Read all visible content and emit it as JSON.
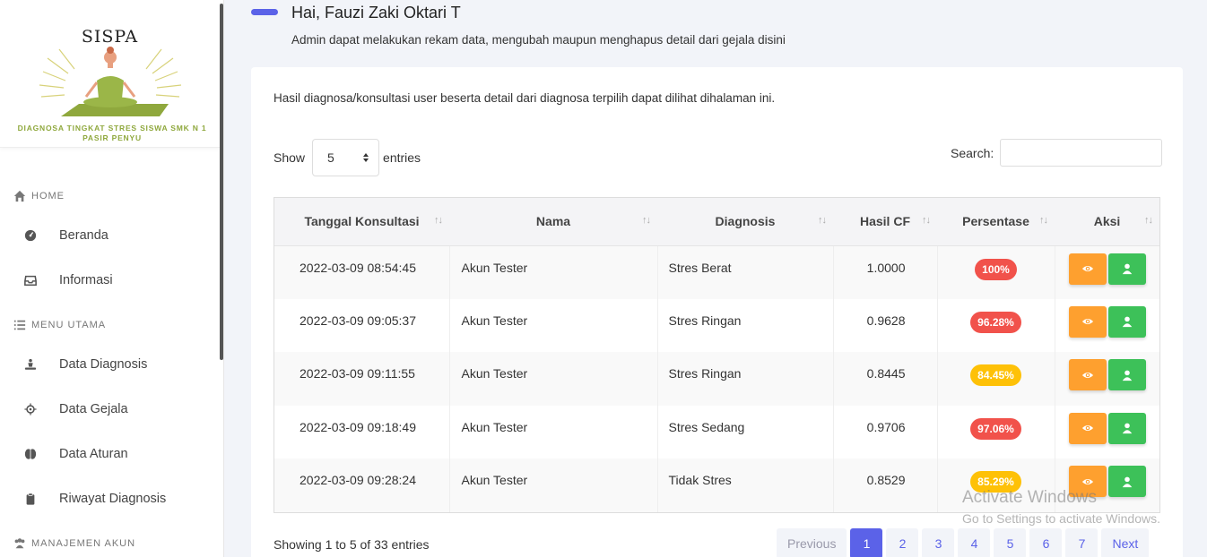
{
  "brand": {
    "title": "SISPA",
    "subtitle": "DIAGNOSA TINGKAT STRES SISWA SMK N 1 PASIR PENYU"
  },
  "sidebar": {
    "sections": [
      {
        "label": "HOME",
        "icon": "home-icon"
      },
      {
        "label": "MENU UTAMA",
        "icon": "list-icon"
      },
      {
        "label": "MANAJEMEN AKUN",
        "icon": "users-icon"
      }
    ],
    "items": [
      {
        "label": "Beranda",
        "icon": "dashboard-icon"
      },
      {
        "label": "Informasi",
        "icon": "inbox-icon"
      },
      {
        "label": "Data Diagnosis",
        "icon": "meditation-icon"
      },
      {
        "label": "Data Gejala",
        "icon": "virus-icon"
      },
      {
        "label": "Data Aturan",
        "icon": "brain-icon"
      },
      {
        "label": "Riwayat Diagnosis",
        "icon": "clipboard-icon"
      }
    ]
  },
  "header": {
    "greeting": "Hai, Fauzi Zaki Oktari T",
    "subtitle": "Admin dapat melakukan rekam data, mengubah maupun menghapus detail dari gejala disini"
  },
  "card": {
    "description": "Hasil diagnosa/konsultasi user beserta detail dari diagnosa terpilih dapat dilihat dihalaman ini."
  },
  "controls": {
    "show_label": "Show",
    "entries_label": "entries",
    "page_size": "5",
    "search_label": "Search:",
    "search_value": ""
  },
  "table": {
    "columns": [
      "Tanggal Konsultasi",
      "Nama",
      "Diagnosis",
      "Hasil CF",
      "Persentase",
      "Aksi"
    ],
    "rows": [
      {
        "date": "2022-03-09 08:54:45",
        "name": "Akun Tester",
        "diagnosis": "Stres Berat",
        "cf": "1.0000",
        "pct": "100%",
        "color": "#f1524b"
      },
      {
        "date": "2022-03-09 09:05:37",
        "name": "Akun Tester",
        "diagnosis": "Stres Ringan",
        "cf": "0.9628",
        "pct": "96.28%",
        "color": "#f1524b"
      },
      {
        "date": "2022-03-09 09:11:55",
        "name": "Akun Tester",
        "diagnosis": "Stres Ringan",
        "cf": "0.8445",
        "pct": "84.45%",
        "color": "#fec107"
      },
      {
        "date": "2022-03-09 09:18:49",
        "name": "Akun Tester",
        "diagnosis": "Stres Sedang",
        "cf": "0.9706",
        "pct": "97.06%",
        "color": "#f1524b"
      },
      {
        "date": "2022-03-09 09:28:24",
        "name": "Akun Tester",
        "diagnosis": "Tidak Stres",
        "cf": "0.8529",
        "pct": "85.29%",
        "color": "#fec107"
      }
    ],
    "action_colors": {
      "view": "#fea02f",
      "user": "#3dc159"
    }
  },
  "footer": {
    "info": "Showing 1 to 5 of 33 entries",
    "pagination": {
      "previous": "Previous",
      "pages": [
        "1",
        "2",
        "3",
        "4",
        "5",
        "6",
        "7"
      ],
      "active": "1",
      "next": "Next"
    }
  },
  "watermark": {
    "line1": "Activate Windows",
    "line2": "Go to Settings to activate Windows."
  },
  "colors": {
    "accent": "#5b62e8",
    "brand_green": "#8fa83d"
  }
}
